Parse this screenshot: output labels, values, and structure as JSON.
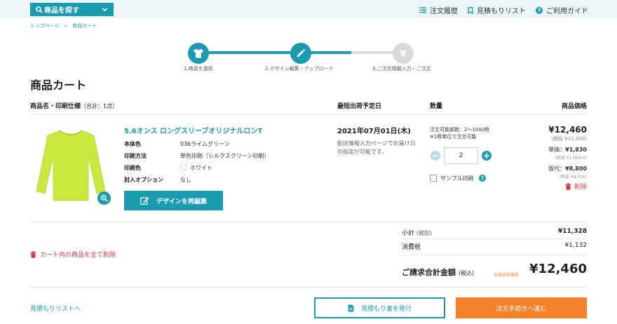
{
  "header": {
    "search_label": "商品を探す",
    "nav": {
      "order_history": "注文履歴",
      "estimate_list": "見積もりリスト",
      "guide": "ご利用ガイド"
    }
  },
  "breadcrumb": {
    "home": "トップページ",
    "sep": ">",
    "current": "商品カート"
  },
  "steps": [
    {
      "label": "1.商品を選択"
    },
    {
      "label": "2.デザイン編集・アップロード"
    },
    {
      "label": "3.ご注文情報入力・ご注文"
    }
  ],
  "page_title": "商品カート",
  "table_headers": {
    "name": "商品名・印刷仕様",
    "count": "（合計：1点）",
    "ship": "最短出荷予定日",
    "qty": "数量",
    "price": "商品価格"
  },
  "item": {
    "name": "5.6オンス ロングスリーブオリジナルロンT",
    "specs": [
      {
        "key": "本体色",
        "value": "036ライムグリーン"
      },
      {
        "key": "印刷方法",
        "value": "単色印刷（シルクスクリーン印刷）"
      },
      {
        "key": "印刷色",
        "value": "ホワイト"
      },
      {
        "key": "封入オプション",
        "value": "なし"
      }
    ],
    "edit_button": "デザインを再編集",
    "ship_date": "2021年07月01日(木)",
    "ship_note": "配送情報入力ページでお届け日の指定が可能です。",
    "qty_range": "注文可能部数：2〜1000枚",
    "qty_unit_note": "※1枚単位で注文可能",
    "qty_value": "2",
    "sample_label": "サンプル印刷",
    "price": "¥12,460",
    "price_tax": "(税抜 ¥11,328)",
    "unit_label": "単価：",
    "unit_price": "¥1,830",
    "unit_tax": "(税抜 ¥1,664.0)",
    "plate_label": "版代：",
    "plate_price": "¥8,800",
    "plate_tax": "(税抜 ¥8,000)",
    "delete": "削除"
  },
  "delete_all": "カート内の商品を全て削除",
  "summary": {
    "subtotal_label": "小計",
    "subtotal_suffix": "(税別)",
    "subtotal": "¥11,328",
    "tax_label": "消費税",
    "tax": "¥1,132",
    "total_label": "ご請求合計金額",
    "total_suffix": "(税込)",
    "free_ship": "全国送料無料",
    "total": "¥12,460"
  },
  "footer": {
    "estimate_link": "見積もりリストへ",
    "estimate_button": "見積もり書を発行",
    "order_button": "注文手続きへ進む"
  },
  "colors": {
    "accent": "#1a9bb0",
    "orange": "#f5822a",
    "red": "#d6363c",
    "shirt": "#c8ea3f"
  }
}
